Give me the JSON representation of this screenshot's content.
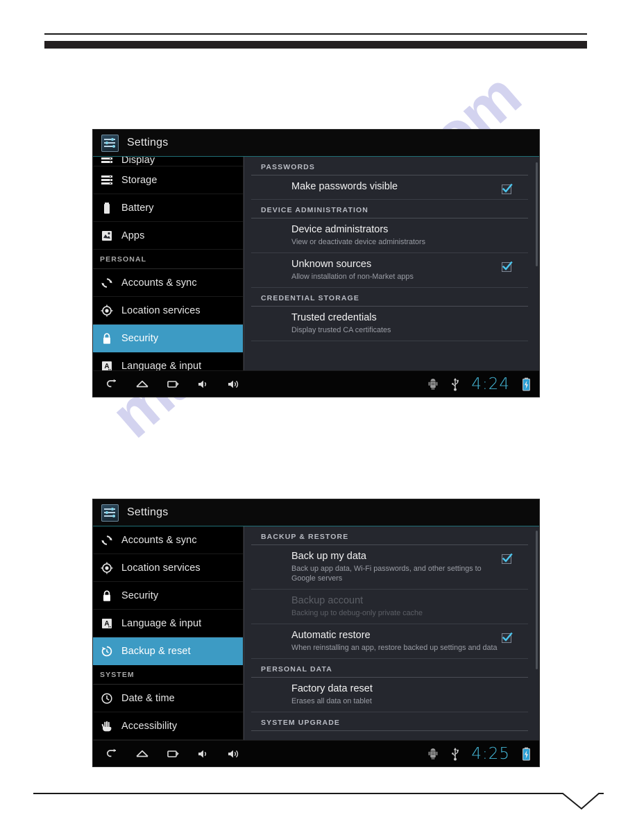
{
  "watermark": {
    "text": "manualshive.com"
  },
  "screens": [
    {
      "id": "security-screen",
      "app_title": "Settings",
      "clock": "4:24",
      "sidebar": {
        "partial_top_item": "Display",
        "items": [
          {
            "type": "item",
            "label": "Storage",
            "icon": "storage-icon",
            "selected": false
          },
          {
            "type": "item",
            "label": "Battery",
            "icon": "battery-icon",
            "selected": false
          },
          {
            "type": "item",
            "label": "Apps",
            "icon": "apps-icon",
            "selected": false
          },
          {
            "type": "header",
            "label": "PERSONAL"
          },
          {
            "type": "item",
            "label": "Accounts & sync",
            "icon": "sync-icon",
            "selected": false
          },
          {
            "type": "item",
            "label": "Location services",
            "icon": "location-icon",
            "selected": false
          },
          {
            "type": "item",
            "label": "Security",
            "icon": "lock-icon",
            "selected": true
          },
          {
            "type": "item",
            "label": "Language & input",
            "icon": "language-icon",
            "selected": false
          }
        ]
      },
      "content": [
        {
          "type": "header",
          "label": "PASSWORDS"
        },
        {
          "type": "row",
          "title": "Make passwords visible",
          "subtitle": "",
          "checkbox": "checked"
        },
        {
          "type": "header",
          "label": "DEVICE ADMINISTRATION"
        },
        {
          "type": "row",
          "title": "Device administrators",
          "subtitle": "View or deactivate device administrators",
          "checkbox": "none"
        },
        {
          "type": "row",
          "title": "Unknown sources",
          "subtitle": "Allow installation of non-Market apps",
          "checkbox": "checked"
        },
        {
          "type": "header",
          "label": "CREDENTIAL STORAGE"
        },
        {
          "type": "row",
          "title": "Trusted credentials",
          "subtitle": "Display trusted CA certificates",
          "checkbox": "none"
        }
      ]
    },
    {
      "id": "backup-reset-screen",
      "app_title": "Settings",
      "clock": "4:25",
      "sidebar": {
        "partial_top_item": "",
        "items": [
          {
            "type": "item",
            "label": "Accounts & sync",
            "icon": "sync-icon",
            "selected": false
          },
          {
            "type": "item",
            "label": "Location services",
            "icon": "location-icon",
            "selected": false
          },
          {
            "type": "item",
            "label": "Security",
            "icon": "lock-icon",
            "selected": false
          },
          {
            "type": "item",
            "label": "Language & input",
            "icon": "language-icon",
            "selected": false
          },
          {
            "type": "item",
            "label": "Backup & reset",
            "icon": "restore-icon",
            "selected": true
          },
          {
            "type": "header",
            "label": "SYSTEM"
          },
          {
            "type": "item",
            "label": "Date & time",
            "icon": "clock-icon",
            "selected": false
          },
          {
            "type": "item",
            "label": "Accessibility",
            "icon": "hand-icon",
            "selected": false
          }
        ]
      },
      "content": [
        {
          "type": "header",
          "label": "BACKUP & RESTORE"
        },
        {
          "type": "row",
          "title": "Back up my data",
          "subtitle": "Back up app data, Wi-Fi passwords, and other settings to Google servers",
          "checkbox": "checked"
        },
        {
          "type": "row",
          "title": "Backup account",
          "subtitle": "Backing up to debug-only private cache",
          "checkbox": "none",
          "disabled": true
        },
        {
          "type": "row",
          "title": "Automatic restore",
          "subtitle": "When reinstalling an app, restore backed up settings and data",
          "checkbox": "checked"
        },
        {
          "type": "header",
          "label": "PERSONAL DATA"
        },
        {
          "type": "row",
          "title": "Factory data reset",
          "subtitle": "Erases all data on tablet",
          "checkbox": "none"
        },
        {
          "type": "header",
          "label": "SYSTEM UPGRADE"
        }
      ]
    }
  ],
  "navbar": {
    "buttons": [
      {
        "name": "back-icon"
      },
      {
        "name": "home-icon"
      },
      {
        "name": "recents-icon"
      },
      {
        "name": "volume-down-icon"
      },
      {
        "name": "volume-up-icon"
      }
    ],
    "status_icons": [
      {
        "name": "android-debug-icon"
      },
      {
        "name": "usb-icon"
      }
    ],
    "battery_icon": "battery-charging-icon"
  },
  "colors": {
    "accent_blue": "#3d9bc4",
    "clock_cyan": "#44b6d6",
    "content_bg": "#25272e",
    "sidebar_bg": "#000000"
  }
}
